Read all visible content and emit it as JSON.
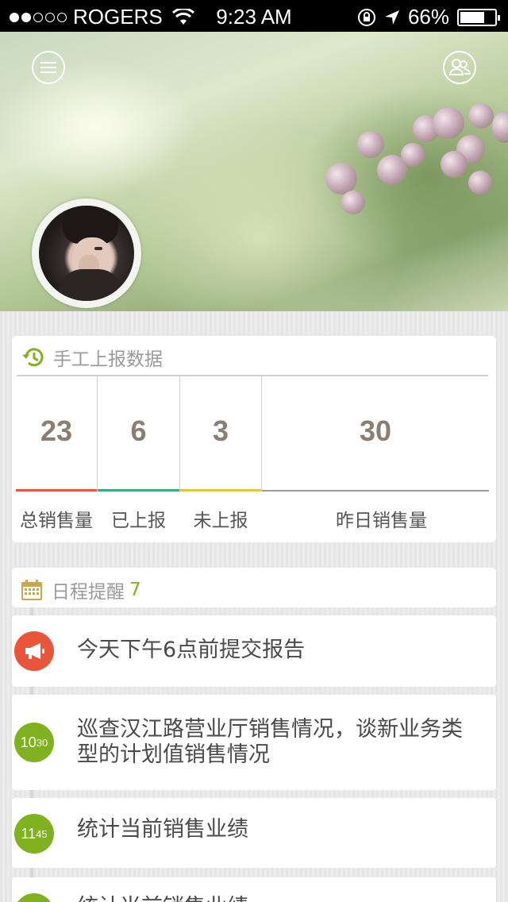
{
  "status_bar": {
    "carrier": "ROGERS",
    "time": "9:23 AM",
    "battery_percent": "66%",
    "signal_bars_filled": 2,
    "signal_bars_total": 5
  },
  "header": {
    "menu_icon": "menu-icon",
    "friends_icon": "friends-icon"
  },
  "sales": {
    "title": "手工上报数据",
    "icon": "history-icon",
    "stats": [
      {
        "value": "23",
        "label": "总销售量",
        "color": "#e8553b"
      },
      {
        "value": "6",
        "label": "已上报",
        "color": "#3aae7e"
      },
      {
        "value": "3",
        "label": "未上报",
        "color": "#e2c63c"
      },
      {
        "value": "30",
        "label": "昨日销售量",
        "color": "#9a9a9a"
      }
    ]
  },
  "schedule": {
    "title": "日程提醒",
    "count": "7",
    "icon": "calendar-icon",
    "items": [
      {
        "badge": "",
        "badge_icon": "megaphone-icon",
        "badge_color": "#e8553b",
        "text": "今天下午6点前提交报告"
      },
      {
        "badge_hour": "10",
        "badge_min": "30",
        "badge_color": "#7fb21f",
        "text": "巡查汉江路营业厅销售情况，谈新业务类型的计划值销售情况"
      },
      {
        "badge_hour": "11",
        "badge_min": "45",
        "badge_color": "#7fb21f",
        "text": "统计当前销售业绩"
      },
      {
        "badge_hour": "",
        "badge_min": "",
        "badge_color": "#7fb21f",
        "text": "统计当前销售业绩"
      }
    ]
  }
}
